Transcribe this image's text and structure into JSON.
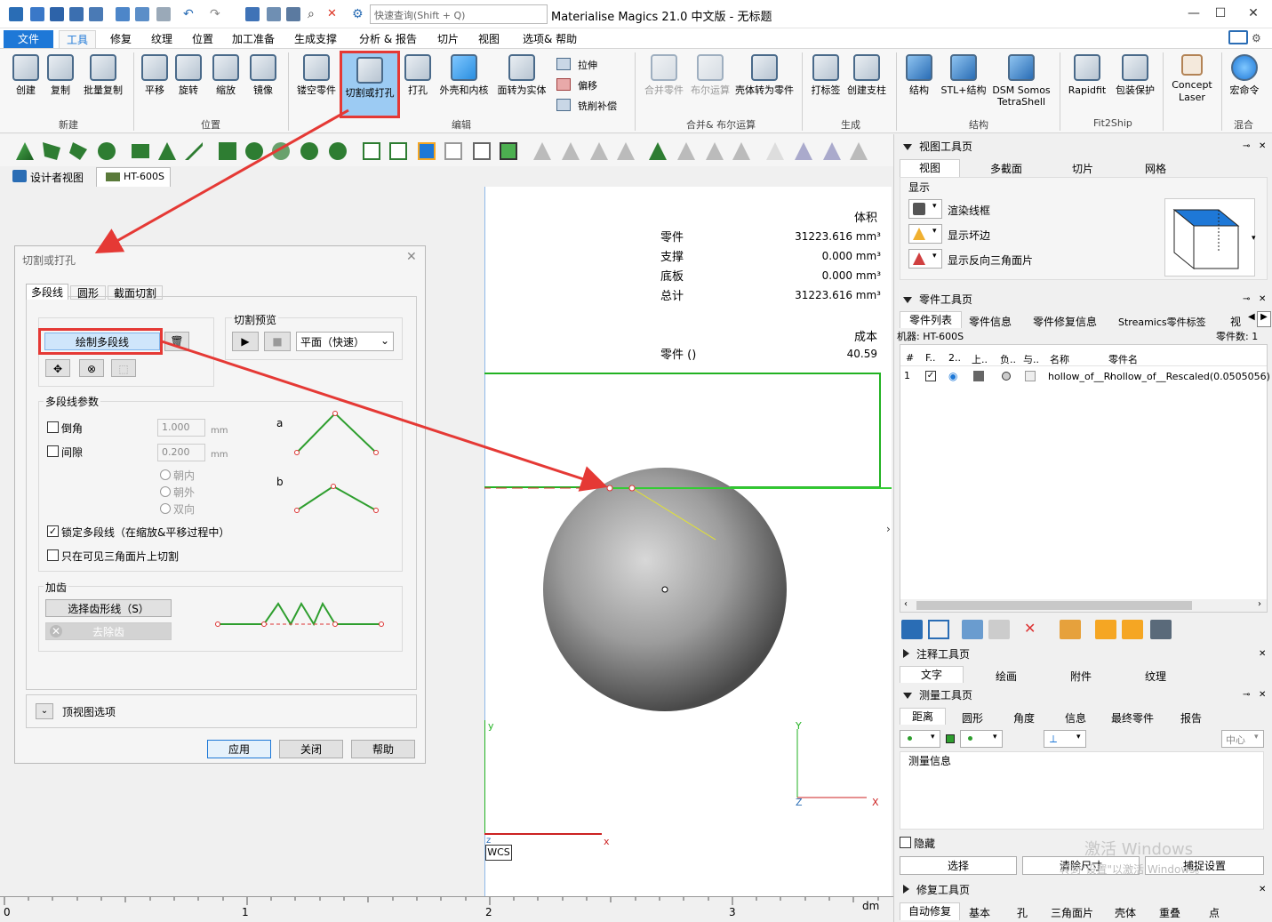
{
  "app": {
    "title": "Materialise Magics 21.0 中文版 - 无标题",
    "search_placeholder": "快速查询(Shift + Q)"
  },
  "menu": {
    "items": [
      "文件",
      "工具",
      "修复",
      "纹理",
      "位置",
      "加工准备",
      "生成支撑",
      "分析 & 报告",
      "切片",
      "视图",
      "选项& 帮助"
    ],
    "active": "工具"
  },
  "ribbon": {
    "buttons": [
      "创建",
      "复制",
      "批量复制",
      "平移",
      "旋转",
      "缩放",
      "镜像",
      "镂空零件",
      "切割或打孔",
      "打孔",
      "外壳和内核",
      "面转为实体",
      "合并零件",
      "布尔运算",
      "壳体转为零件",
      "打标签",
      "创建支柱",
      "结构",
      "STL+结构",
      "DSM Somos TetraShell",
      "Rapidfit",
      "包装保护",
      "Concept Laser",
      "宏命令"
    ],
    "small_buttons": [
      "拉伸",
      "偏移",
      "铣削补偿"
    ],
    "groups": [
      "新建",
      "位置",
      "编辑",
      "合并& 布尔运算",
      "生成",
      "结构",
      "Fit2Ship",
      "混合"
    ]
  },
  "views": {
    "designer": "设计者视图",
    "machine": "HT-600S"
  },
  "dialog": {
    "title": "切割或打孔",
    "tabs": [
      "多段线",
      "圆形",
      "截面切割"
    ],
    "draw_polyline": "绘制多段线",
    "preview_label": "切割预览",
    "preview_mode": "平面（快速）",
    "params_label": "多段线参数",
    "chamfer_label": "倒角",
    "chamfer_value": "1.000",
    "unit1": "mm",
    "gap_label": "间隙",
    "gap_value": "0.200",
    "unit2": "mm",
    "radio": [
      "朝内",
      "朝外",
      "双向"
    ],
    "diagram_a": "a",
    "diagram_b": "b",
    "lock_label": "锁定多段线（在缩放&平移过程中）",
    "lock_checked": true,
    "visible_only": "只在可见三角面片上切割",
    "teeth_label": "加齿",
    "select_teeth": "选择齿形线（S）",
    "remove_teeth": "去除齿",
    "top_view": "顶视图选项",
    "apply": "应用",
    "close": "关闭",
    "help": "帮助"
  },
  "viewport": {
    "volume_header": "体积",
    "rows": [
      {
        "k": "零件",
        "v": "31223.616 mm³"
      },
      {
        "k": "支撑",
        "v": "0.000 mm³"
      },
      {
        "k": "底板",
        "v": "0.000 mm³"
      },
      {
        "k": "总计",
        "v": "31223.616 mm³"
      }
    ],
    "cost_header": "成本",
    "cost_row": {
      "k": "零件 ()",
      "v": "40.59"
    },
    "axis": {
      "y": "y",
      "x": "x",
      "z": "z",
      "wcs": "WCS",
      "Y": "Y",
      "X": "X",
      "Z": "Z"
    }
  },
  "ruler": {
    "ticks": [
      "0",
      "1",
      "2",
      "3"
    ],
    "unit": "dm"
  },
  "right": {
    "view_toolbar": "视图工具页",
    "view_tabs": [
      "视图",
      "多截面",
      "切片",
      "网格"
    ],
    "display_label": "显示",
    "display_items": [
      "渲染线框",
      "显示坏边",
      "显示反向三角面片"
    ],
    "parts_toolbar": "零件工具页",
    "parts_tabs": [
      "零件列表",
      "零件信息",
      "零件修复信息",
      "Streamics零件标签",
      "视"
    ],
    "machine": "机器: HT-600S",
    "part_count_label": "零件数: 1",
    "columns": [
      "#",
      "F..",
      "2..",
      "上..",
      "负..",
      "与..",
      "名称",
      "零件名"
    ],
    "row": {
      "num": "1",
      "name": "hollow_of__Re",
      "part": "hollow_of__Rescaled(0.0505056)"
    },
    "annot_toolbar": "注释工具页",
    "annot_tabs": [
      "文字",
      "绘画",
      "附件",
      "纹理"
    ],
    "measure_toolbar": "测量工具页",
    "measure_tabs": [
      "距离",
      "圆形",
      "角度",
      "信息",
      "最终零件",
      "报告"
    ],
    "center": "中心",
    "measure_info": "测量信息",
    "hide": "隐藏",
    "select": "选择",
    "clear_size": "清除尺寸",
    "snap_settings": "捕捉设置",
    "repair_toolbar": "修复工具页",
    "repair_tabs": [
      "自动修复",
      "基本",
      "孔",
      "三角面片",
      "壳体",
      "重叠",
      "点"
    ],
    "watermark1": "激活 Windows",
    "watermark2": "转到\"设置\"以激活 Windows。"
  },
  "colors": {
    "accent": "#1e78d7",
    "highlight": "#e53935",
    "green": "#22b222"
  }
}
